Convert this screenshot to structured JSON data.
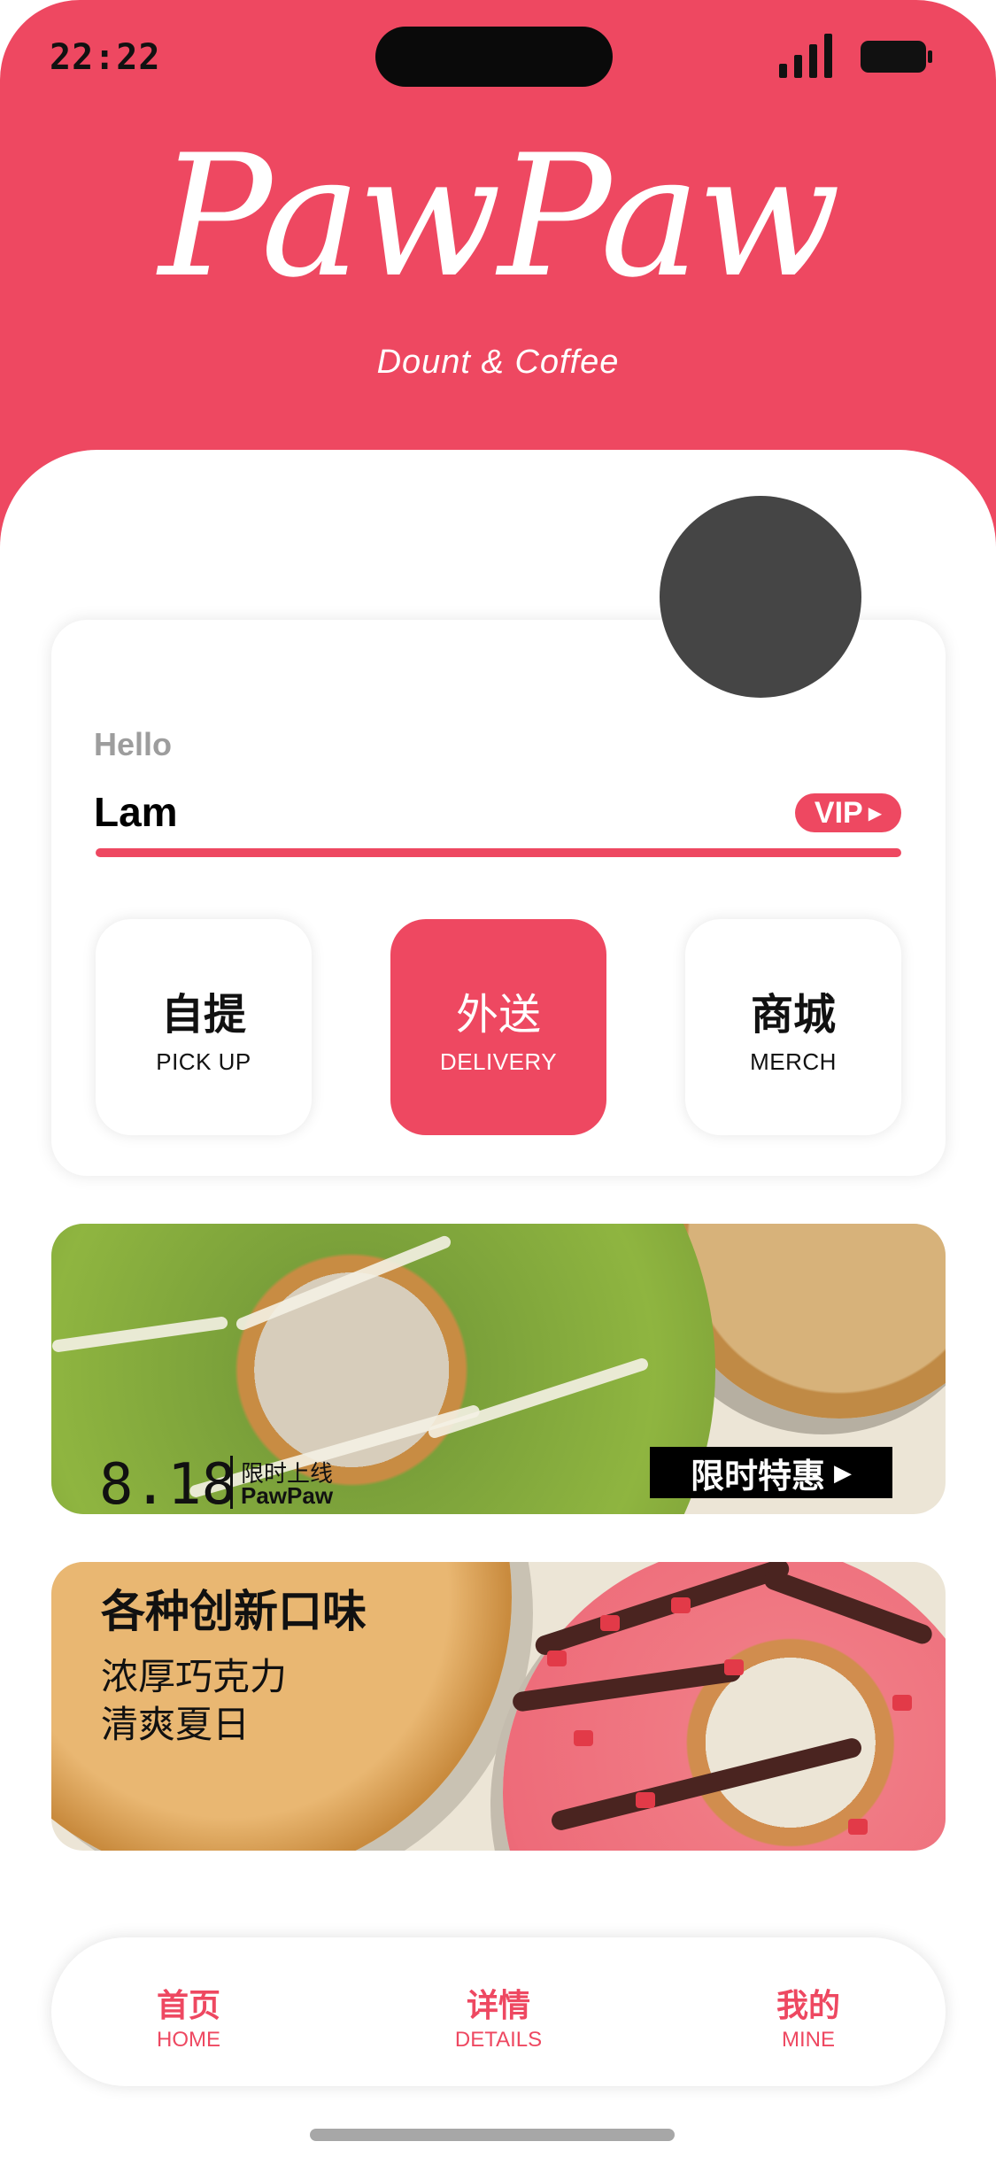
{
  "status_bar": {
    "time": "22:22"
  },
  "brand": {
    "logo_text": "PawPaw",
    "tagline": "Dount & Coffee"
  },
  "colors": {
    "brand_red": "#ee4861",
    "dark": "#111111",
    "avatar_gray": "#454545"
  },
  "user": {
    "greeting": "Hello",
    "name": "Lam",
    "vip_label": "VIP"
  },
  "order_modes": [
    {
      "zh": "自提",
      "en": "PICK UP",
      "selected": false
    },
    {
      "zh": "外送",
      "en": "DELIVERY",
      "selected": true
    },
    {
      "zh": "商城",
      "en": "MERCH",
      "selected": false
    }
  ],
  "banner_promo": {
    "date": "8.18",
    "sub_line1": "限时上线",
    "sub_line2": "PawPaw",
    "cta_label": "限时特惠"
  },
  "banner_flavors": {
    "title": "各种创新口味",
    "line1": "浓厚巧克力",
    "line2": "清爽夏日"
  },
  "tab_bar": [
    {
      "zh": "首页",
      "en": "HOME"
    },
    {
      "zh": "详情",
      "en": "DETAILS"
    },
    {
      "zh": "我的",
      "en": "MINE"
    }
  ],
  "icons": [
    "signal-icon",
    "battery-icon",
    "play-arrow-icon"
  ]
}
